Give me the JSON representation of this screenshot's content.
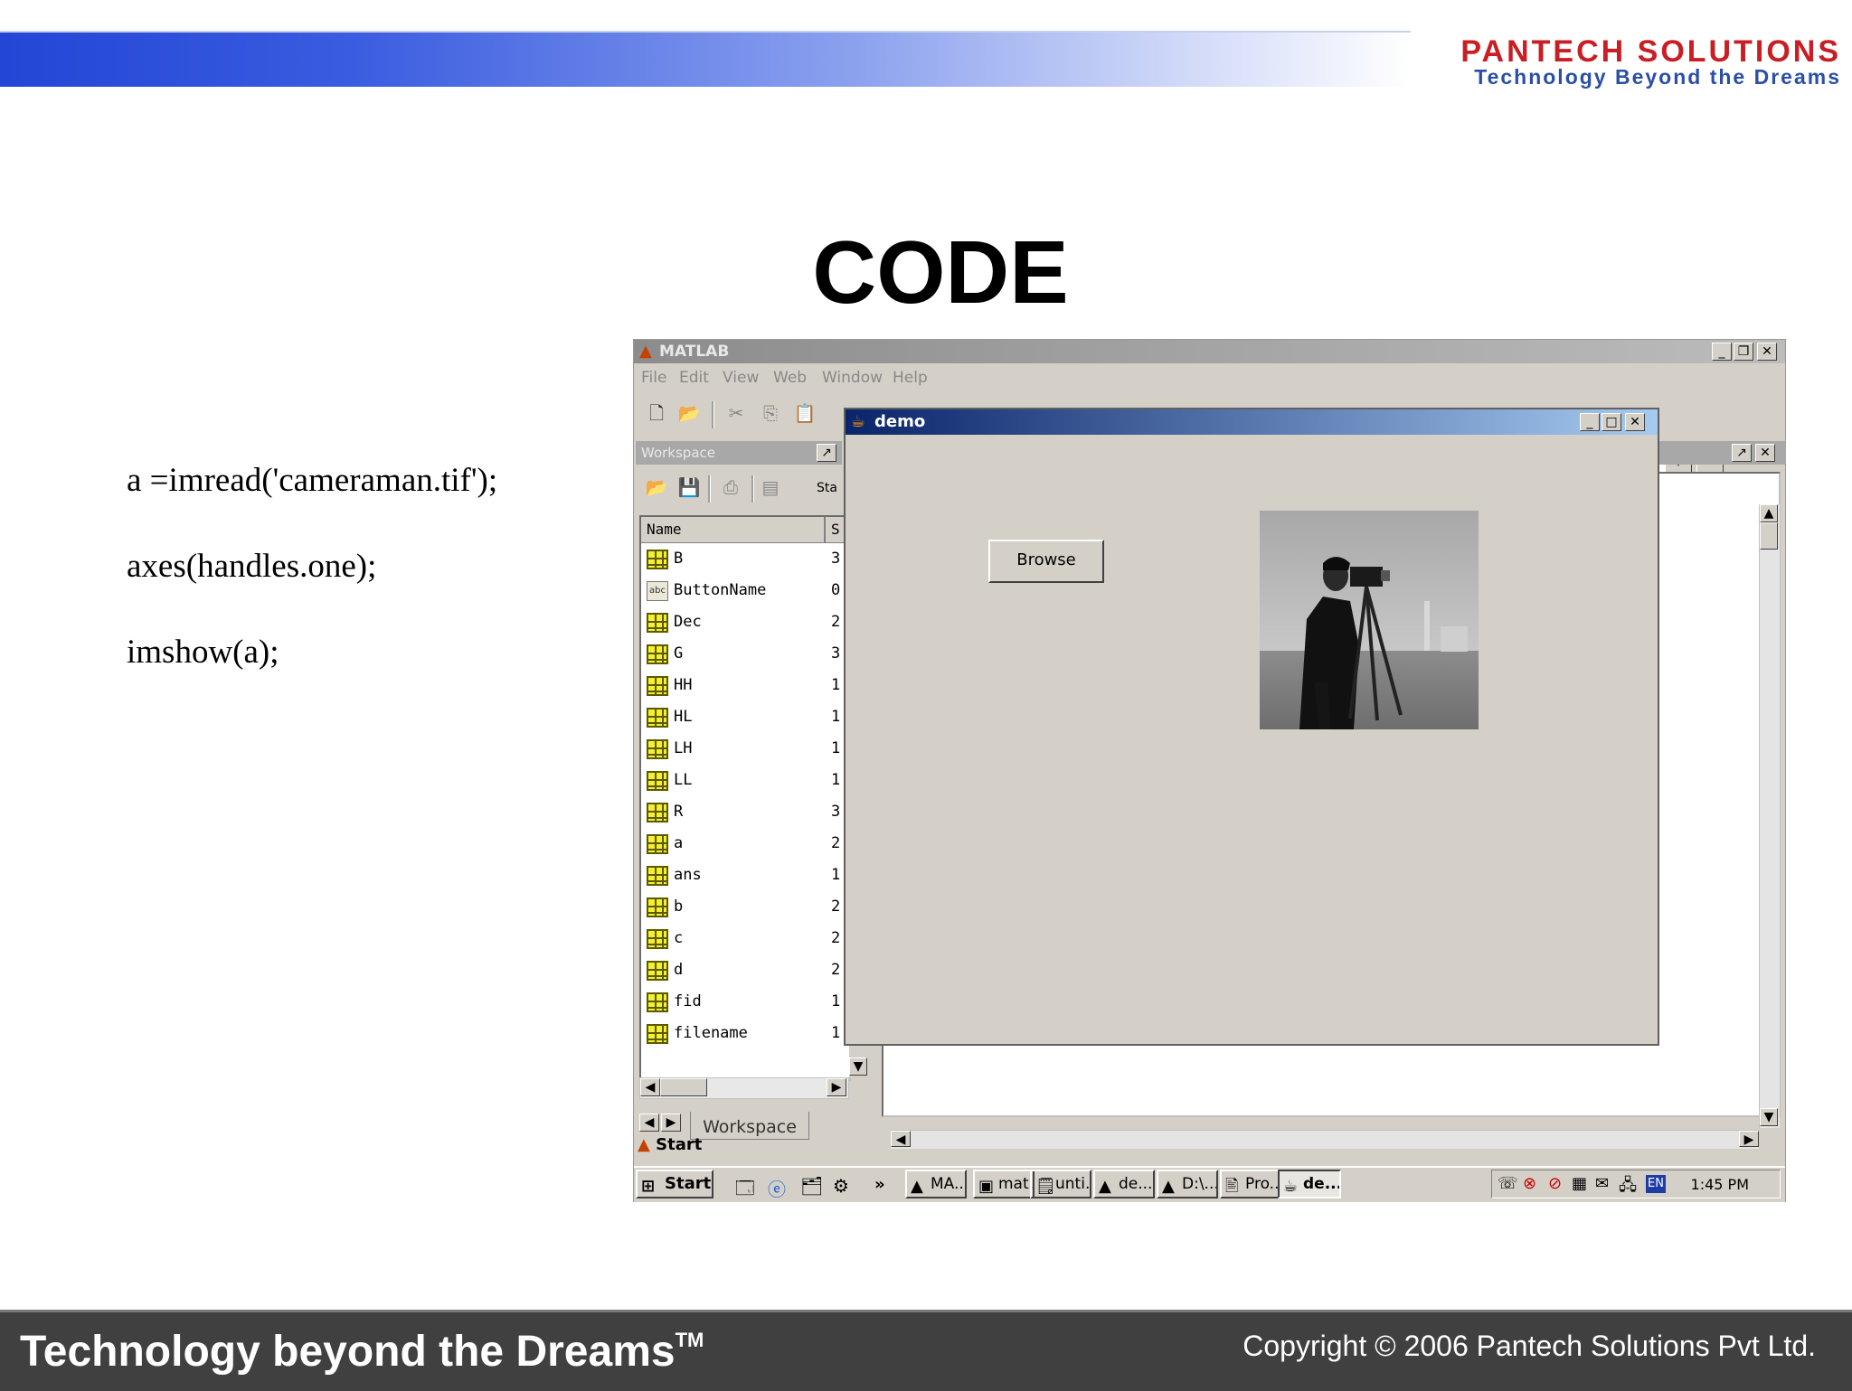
{
  "brand": {
    "logo_text": "PANTECH SOLUTIONS",
    "tagline": "Technology Beyond the Dreams"
  },
  "slide": {
    "title": "CODE",
    "code_lines": [
      "a =imread('cameraman.tif');",
      "axes(handles.one);",
      "imshow(a);"
    ]
  },
  "footer": {
    "left_text": "Technology beyond the Dreams",
    "trademark": "TM",
    "right_text": "Copyright © 2006 Pantech Solutions Pvt Ltd."
  },
  "matlab": {
    "title": "MATLAB",
    "menus": [
      "File",
      "Edit",
      "View",
      "Web",
      "Window",
      "Help"
    ],
    "workspace": {
      "title": "Workspace",
      "toolbar_partial": "Sta",
      "header_name": "Name",
      "header_size": "S",
      "rows": [
        {
          "name": "B",
          "size": "3",
          "type": "matrix"
        },
        {
          "name": "ButtonName",
          "size": "0",
          "type": "char"
        },
        {
          "name": "Dec",
          "size": "2",
          "type": "matrix"
        },
        {
          "name": "G",
          "size": "3",
          "type": "matrix"
        },
        {
          "name": "HH",
          "size": "1",
          "type": "matrix"
        },
        {
          "name": "HL",
          "size": "1",
          "type": "matrix"
        },
        {
          "name": "LH",
          "size": "1",
          "type": "matrix"
        },
        {
          "name": "LL",
          "size": "1",
          "type": "matrix"
        },
        {
          "name": "R",
          "size": "3",
          "type": "matrix"
        },
        {
          "name": "a",
          "size": "2",
          "type": "matrix"
        },
        {
          "name": "ans",
          "size": "1",
          "type": "matrix"
        },
        {
          "name": "b",
          "size": "2",
          "type": "matrix"
        },
        {
          "name": "c",
          "size": "2",
          "type": "matrix"
        },
        {
          "name": "d",
          "size": "2",
          "type": "matrix"
        },
        {
          "name": "fid",
          "size": "1",
          "type": "matrix"
        },
        {
          "name": "filename",
          "size": "1",
          "type": "matrix"
        }
      ],
      "tab_label": "Workspace"
    },
    "start_label": "Start"
  },
  "demo": {
    "title": "demo",
    "browse_label": "Browse"
  },
  "taskbar": {
    "start_label": "Start",
    "more_label": "»",
    "tasks": [
      {
        "label": "MA...",
        "active": false
      },
      {
        "label": "mat...",
        "active": false
      },
      {
        "label": "unti...",
        "active": false
      },
      {
        "label": "de...",
        "active": false
      },
      {
        "label": "D:\\...",
        "active": false
      },
      {
        "label": "Pro...",
        "active": false
      },
      {
        "label": "de...",
        "active": true
      }
    ],
    "language": "EN",
    "clock": "1:45 PM"
  }
}
